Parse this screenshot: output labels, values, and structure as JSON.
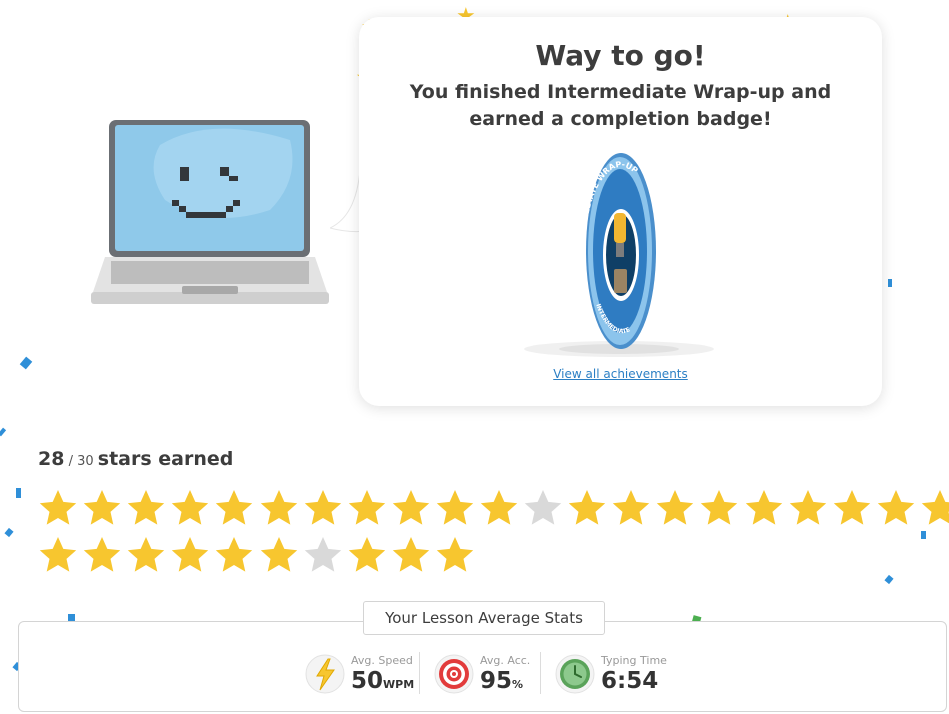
{
  "card": {
    "title": "Way to go!",
    "subtitle": "You finished Intermediate Wrap-up and earned a completion badge!",
    "badge_text_top": "INTERMEDIATE WRAP-UP",
    "badge_text_bottom": "INTERMEDIATE",
    "link": "View all achievements"
  },
  "stars": {
    "earned": "28",
    "separator": " / 30 ",
    "label": "stars earned",
    "total": 30,
    "row1": [
      1,
      1,
      1,
      1,
      1,
      1,
      1,
      1,
      1,
      1,
      1,
      0,
      1,
      1,
      1,
      1,
      1,
      1,
      1,
      1,
      1
    ],
    "row2": [
      1,
      1,
      1,
      1,
      1,
      1,
      0,
      1,
      1,
      1
    ]
  },
  "stats": {
    "header": "Your Lesson Average Stats",
    "speed": {
      "label": "Avg. Speed",
      "value": "50",
      "unit": "WPM",
      "icon": "lightning-icon"
    },
    "accuracy": {
      "label": "Avg. Acc.",
      "value": "95",
      "unit": "%",
      "icon": "target-icon"
    },
    "time": {
      "label": "Typing Time",
      "value": "6:54",
      "icon": "clock-icon"
    }
  },
  "colors": {
    "star_filled": "#f7c62f",
    "star_empty": "#d9d9d9",
    "link": "#2b7fc4",
    "confetti_blue": "#2f8fd8",
    "confetti_green": "#4caf50"
  }
}
